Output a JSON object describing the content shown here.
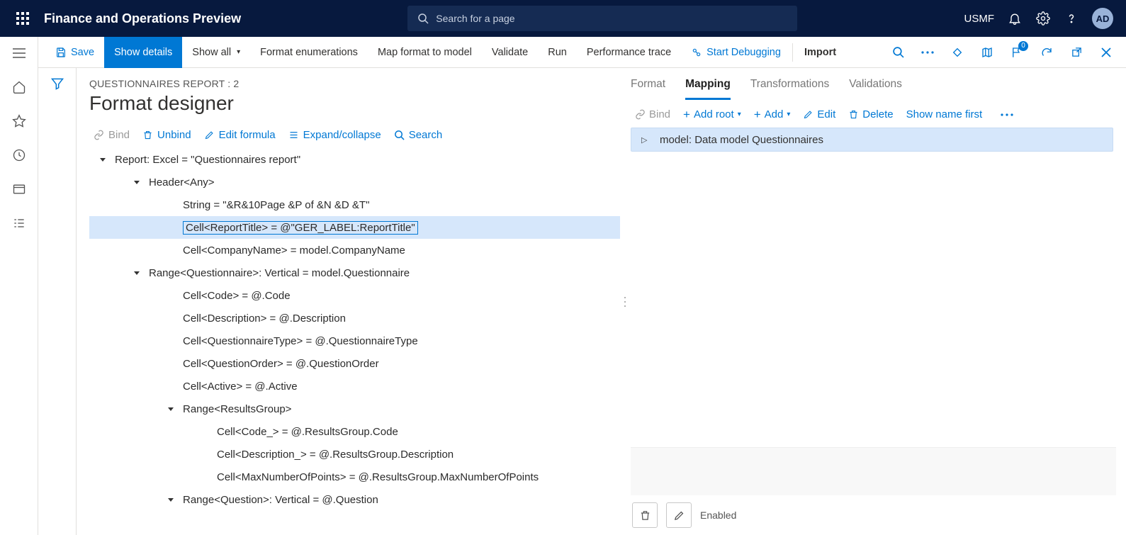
{
  "app_title": "Finance and Operations Preview",
  "search_placeholder": "Search for a page",
  "company": "USMF",
  "avatar": "AD",
  "actionbar": {
    "save": "Save",
    "show_details": "Show details",
    "show_all": "Show all",
    "format_enum": "Format enumerations",
    "map_format": "Map format to model",
    "validate": "Validate",
    "run": "Run",
    "perf_trace": "Performance trace",
    "start_debug": "Start Debugging",
    "import": "Import",
    "badge": "0"
  },
  "breadcrumb": "QUESTIONNAIRES REPORT : 2",
  "page_title": "Format designer",
  "tree_toolbar": {
    "bind": "Bind",
    "unbind": "Unbind",
    "edit_formula": "Edit formula",
    "expand": "Expand/collapse",
    "search": "Search"
  },
  "tree": [
    {
      "indent": 0,
      "caret": "down",
      "text": "Report: Excel = \"Questionnaires report\""
    },
    {
      "indent": 1,
      "caret": "down",
      "text": "Header<Any>"
    },
    {
      "indent": 2,
      "caret": "",
      "text": "String = \"&R&10Page &P of &N &D &T\""
    },
    {
      "indent": 2,
      "caret": "",
      "text": "Cell<ReportTitle> = @\"GER_LABEL:ReportTitle\"",
      "selected": true
    },
    {
      "indent": 2,
      "caret": "",
      "text": "Cell<CompanyName> = model.CompanyName"
    },
    {
      "indent": 1,
      "caret": "down",
      "text": "Range<Questionnaire>: Vertical = model.Questionnaire"
    },
    {
      "indent": 2,
      "caret": "",
      "text": "Cell<Code> = @.Code"
    },
    {
      "indent": 2,
      "caret": "",
      "text": "Cell<Description> = @.Description"
    },
    {
      "indent": 2,
      "caret": "",
      "text": "Cell<QuestionnaireType> = @.QuestionnaireType"
    },
    {
      "indent": 2,
      "caret": "",
      "text": "Cell<QuestionOrder> = @.QuestionOrder"
    },
    {
      "indent": 2,
      "caret": "",
      "text": "Cell<Active> = @.Active"
    },
    {
      "indent": 2,
      "caret": "down",
      "text": "Range<ResultsGroup>"
    },
    {
      "indent": 3,
      "caret": "",
      "text": "Cell<Code_> = @.ResultsGroup.Code"
    },
    {
      "indent": 3,
      "caret": "",
      "text": "Cell<Description_> = @.ResultsGroup.Description"
    },
    {
      "indent": 3,
      "caret": "",
      "text": "Cell<MaxNumberOfPoints> = @.ResultsGroup.MaxNumberOfPoints"
    },
    {
      "indent": 2,
      "caret": "down",
      "text": "Range<Question>: Vertical = @.Question"
    }
  ],
  "tabs": {
    "format": "Format",
    "mapping": "Mapping",
    "transformations": "Transformations",
    "validations": "Validations"
  },
  "right_toolbar": {
    "bind": "Bind",
    "add_root": "Add root",
    "add": "Add",
    "edit": "Edit",
    "delete": "Delete",
    "show_name": "Show name first"
  },
  "model_row": "model: Data model Questionnaires",
  "enabled_label": "Enabled"
}
